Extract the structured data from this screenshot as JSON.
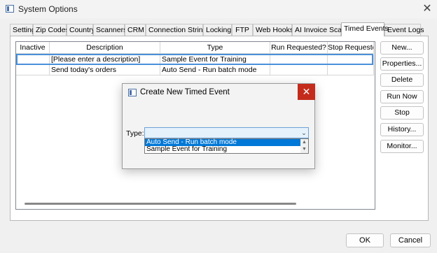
{
  "window": {
    "title": "System Options",
    "close_glyph": "✕"
  },
  "tabs": [
    {
      "label": "Settings"
    },
    {
      "label": "Zip Codes"
    },
    {
      "label": "Country"
    },
    {
      "label": "Scanners"
    },
    {
      "label": "CRM"
    },
    {
      "label": "Connection Strings"
    },
    {
      "label": "Locking"
    },
    {
      "label": "FTP"
    },
    {
      "label": "Web Hooks"
    },
    {
      "label": "AI Invoice Scan"
    },
    {
      "label": "Timed Events",
      "active": true
    },
    {
      "label": "Event Logs"
    }
  ],
  "grid": {
    "columns": [
      "Inactive",
      "Description",
      "Type",
      "Run Requested?",
      "Stop Requested?"
    ],
    "rows": [
      {
        "inactive": "",
        "description": "[Please enter a description]",
        "type": "Sample Event for Training",
        "run_requested": "",
        "stop_requested": ""
      },
      {
        "inactive": "",
        "description": "Send today's orders",
        "type": "Auto Send - Run batch mode",
        "run_requested": "",
        "stop_requested": ""
      }
    ]
  },
  "side_buttons": [
    "New...",
    "Properties...",
    "Delete",
    "Run Now",
    "Stop",
    "History...",
    "Monitor..."
  ],
  "footer": {
    "ok": "OK",
    "cancel": "Cancel"
  },
  "dialog": {
    "title": "Create New Timed Event",
    "close_glyph": "✕",
    "type_label": "Type:",
    "type_value": "",
    "options": [
      "Auto Send - Run batch mode",
      "Sample Event for Training"
    ],
    "selected_option_index": 0,
    "arrow_glyph": "⌄",
    "scroll_up_glyph": "▲",
    "scroll_down_glyph": "▼"
  }
}
